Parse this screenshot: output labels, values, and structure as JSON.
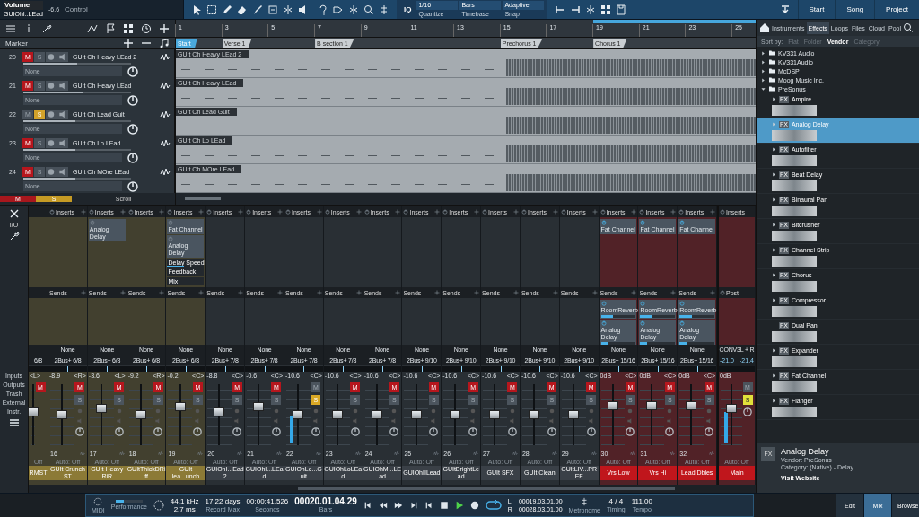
{
  "toolbar": {
    "control": {
      "param": "Volume",
      "channel": "GUIOhI..LEad",
      "value": "-6.6",
      "label": "Control"
    },
    "iq": "IQ",
    "quantize": {
      "value": "1/16",
      "label": "Quantize"
    },
    "timebase": {
      "value": "Bars",
      "label": "Timebase"
    },
    "snap": {
      "value": "Adaptive",
      "label": "Snap"
    },
    "pages": [
      {
        "label": "Start"
      },
      {
        "label": "Song"
      },
      {
        "label": "Project"
      }
    ]
  },
  "ruler": {
    "bars": [
      "1",
      "3",
      "5",
      "7",
      "9",
      "11",
      "13",
      "15",
      "17",
      "19",
      "21",
      "23",
      "25"
    ]
  },
  "markers": {
    "title": "Marker",
    "items": [
      {
        "name": "Start"
      },
      {
        "name": "Verse 1"
      },
      {
        "name": "B section 1"
      },
      {
        "name": "Prechorus 1"
      },
      {
        "name": "Chorus 1"
      }
    ]
  },
  "tracks": [
    {
      "number": "20",
      "name": "GUIt Ch Heavy LEad 2",
      "mute": true,
      "solo": false,
      "mute_label": "M",
      "solo_label": "S",
      "input": "None",
      "level": 0.5,
      "clip_name": "GUIt Ch Heavy LEad 2"
    },
    {
      "number": "21",
      "name": "GUIt Ch Heavy LEad",
      "mute": true,
      "solo": false,
      "mute_label": "M",
      "solo_label": "S",
      "input": "None",
      "level": 0.55,
      "clip_name": "GUIt Ch Heavy LEad"
    },
    {
      "number": "22",
      "name": "GUIt Ch Lead Guit",
      "mute": false,
      "solo": true,
      "mute_label": "M",
      "solo_label": "S",
      "input": "None",
      "level": 0.48,
      "clip_name": "GUIt Ch Lead Guit"
    },
    {
      "number": "23",
      "name": "GUIt Ch Lo LEad",
      "mute": true,
      "solo": false,
      "mute_label": "M",
      "solo_label": "S",
      "input": "None",
      "level": 0.48,
      "clip_name": "GUIt Ch Lo LEad"
    },
    {
      "number": "24",
      "name": "GUIt Ch MOre LEad",
      "mute": true,
      "solo": false,
      "mute_label": "M",
      "solo_label": "S",
      "input": "None",
      "level": 0.48,
      "clip_name": "GUIt Ch MOre LEad"
    }
  ],
  "arrange_footer": {
    "mute": "M",
    "solo": "S",
    "mode": "Scroll"
  },
  "mixer": {
    "panel": {
      "io": "I/O",
      "items": [
        "Inputs",
        "Outputs",
        "Trash",
        "External",
        "Instr."
      ]
    },
    "channels": [
      {
        "kind": "partial",
        "label": "RMST",
        "color": "#8c7a36",
        "routing": "6/8",
        "pan": "<L>",
        "mute": true,
        "mute_label": "M",
        "automation": "Off",
        "level": 0.55
      },
      {
        "kind": "strip",
        "number": "16",
        "label": "GUIt Crunch ST",
        "color": "#8c7a36",
        "inserts_label": "Inserts",
        "sends_label": "Sends",
        "input": "None",
        "routing": "2Bus+ 6/8",
        "volume": "-8.9",
        "pan": "<R>",
        "mute": true,
        "solo": false,
        "mute_label": "M",
        "solo_label": "S",
        "level": 0.5,
        "automation": "Auto: Off"
      },
      {
        "kind": "strip",
        "number": "17",
        "label": "GUIt Heavy RiR",
        "color": "#8c7a36",
        "inserts_label": "Inserts",
        "inserts": [
          {
            "name": "Analog Delay",
            "on": false
          }
        ],
        "sends_label": "Sends",
        "input": "None",
        "routing": "2Bus+ 6/8",
        "volume": "-3.6",
        "pan": "<L>",
        "mute": true,
        "solo": false,
        "mute_label": "M",
        "solo_label": "S",
        "level": 0.62,
        "automation": "Auto: Off"
      },
      {
        "kind": "strip",
        "number": "18",
        "label": "GUItThickDRiff",
        "color": "#8c7a36",
        "inserts_label": "Inserts",
        "sends_label": "Sends",
        "input": "None",
        "routing": "2Bus+ 6/8",
        "volume": "-9.2",
        "pan": "<R>",
        "mute": true,
        "solo": false,
        "mute_label": "M",
        "solo_label": "S",
        "level": 0.5,
        "automation": "Auto: Off"
      },
      {
        "kind": "strip",
        "number": "19",
        "label": "GUIt lea...unch",
        "color": "#8c7a36",
        "inserts_label": "Inserts",
        "inserts": [
          {
            "name": "Fat Channel",
            "on": false
          },
          {
            "name": "Analog Delay",
            "on": false,
            "params": [
              {
                "name": "Delay Speed",
                "level": 0.45
              },
              {
                "name": "Feedback",
                "level": 0.12
              },
              {
                "name": "Mix",
                "level": 0.1
              }
            ]
          }
        ],
        "sends_label": "Sends",
        "input": "None",
        "routing": "2Bus+ 6/8",
        "volume": "-0.2",
        "pan": "<C>",
        "mute": true,
        "solo": false,
        "mute_label": "M",
        "solo_label": "S",
        "level": 0.65,
        "automation": "Auto: Off"
      },
      {
        "kind": "strip",
        "number": "20",
        "label": "GUIOhI...Ead2",
        "color": "#3a4047",
        "inserts_label": "Inserts",
        "sends_label": "Sends",
        "input": "None",
        "routing": "2Bus+ 7/8",
        "volume": "-8.8",
        "pan": "<C>",
        "mute": true,
        "solo": false,
        "mute_label": "M",
        "solo_label": "S",
        "level": 0.55,
        "automation": "Auto: Off"
      },
      {
        "kind": "strip",
        "number": "21",
        "label": "GUIOhI...LEad",
        "color": "#3a4047",
        "inserts_label": "Inserts",
        "sends_label": "Sends",
        "input": "None",
        "routing": "2Bus+ 7/8",
        "volume": "-0.6",
        "pan": "<C>",
        "mute": true,
        "solo": false,
        "mute_label": "M",
        "solo_label": "S",
        "level": 0.65,
        "automation": "Auto: Off"
      },
      {
        "kind": "strip",
        "number": "22",
        "label": "GUIOhLe...Guit",
        "color": "#3a4047",
        "inserts_label": "Inserts",
        "sends_label": "Sends",
        "input": "None",
        "routing": "2Bus+ 7/8",
        "volume": "-10.6",
        "pan": "<C>",
        "mute": false,
        "solo": true,
        "mute_label": "M",
        "solo_label": "S",
        "level": 0.5,
        "meter": {
          "level": 0.45
        },
        "automation": "Auto: Off"
      },
      {
        "kind": "strip",
        "number": "23",
        "label": "GUIOhLoLEad",
        "color": "#3a4047",
        "inserts_label": "Inserts",
        "sends_label": "Sends",
        "input": "None",
        "routing": "2Bus+ 7/8",
        "volume": "-10.6",
        "pan": "<C>",
        "mute": true,
        "solo": false,
        "mute_label": "M",
        "solo_label": "S",
        "level": 0.5,
        "automation": "Auto: Off"
      },
      {
        "kind": "strip",
        "number": "24",
        "label": "GUIOhM...LEad",
        "color": "#3a4047",
        "inserts_label": "Inserts",
        "sends_label": "Sends",
        "input": "None",
        "routing": "2Bus+ 7/8",
        "volume": "-10.6",
        "pan": "<C>",
        "mute": true,
        "solo": false,
        "mute_label": "M",
        "solo_label": "S",
        "level": 0.5,
        "automation": "Auto: Off"
      },
      {
        "kind": "strip",
        "number": "25",
        "label": "GUIOhIILead",
        "color": "#3a4047",
        "inserts_label": "Inserts",
        "sends_label": "Sends",
        "input": "None",
        "routing": "2Bus+ 9/10",
        "volume": "-10.6",
        "pan": "<C>",
        "mute": true,
        "solo": false,
        "mute_label": "M",
        "solo_label": "S",
        "level": 0.5,
        "automation": "Auto: Off"
      },
      {
        "kind": "strip",
        "number": "26",
        "label": "GUItBrightLead",
        "color": "#3a4047",
        "inserts_label": "Inserts",
        "sends_label": "Sends",
        "input": "None",
        "routing": "2Bus+ 9/10",
        "volume": "-10.6",
        "pan": "<C>",
        "mute": true,
        "solo": false,
        "mute_label": "M",
        "solo_label": "S",
        "level": 0.5,
        "automation": "Auto: Off"
      },
      {
        "kind": "strip",
        "number": "27",
        "label": "GUIt SFX",
        "color": "#3a4047",
        "inserts_label": "Inserts",
        "sends_label": "Sends",
        "input": "None",
        "routing": "2Bus+ 9/10",
        "volume": "-10.6",
        "pan": "<C>",
        "mute": true,
        "solo": false,
        "mute_label": "M",
        "solo_label": "S",
        "level": 0.5,
        "automation": "Auto: Off"
      },
      {
        "kind": "strip",
        "number": "28",
        "label": "GUIt Clean",
        "color": "#3a4047",
        "inserts_label": "Inserts",
        "sends_label": "Sends",
        "input": "None",
        "routing": "2Bus+ 9/10",
        "volume": "-10.6",
        "pan": "<C>",
        "mute": true,
        "solo": false,
        "mute_label": "M",
        "solo_label": "S",
        "level": 0.5,
        "automation": "Auto: Off"
      },
      {
        "kind": "strip",
        "number": "29",
        "label": "GUItLIV...PREF",
        "color": "#3a4047",
        "inserts_label": "Inserts",
        "sends_label": "Sends",
        "input": "None",
        "routing": "2Bus+ 9/10",
        "volume": "-10.6",
        "pan": "<C>",
        "mute": true,
        "solo": false,
        "mute_label": "M",
        "solo_label": "S",
        "level": 0.5,
        "automation": "Auto: Off"
      },
      {
        "kind": "strip",
        "number": "30",
        "label": "Vrs Low",
        "color": "#c0161c",
        "inserts_label": "Inserts",
        "inserts": [
          {
            "name": "Fat Channel",
            "on": true
          }
        ],
        "sends_label": "Sends",
        "sends": [
          {
            "name": "RoomReverb",
            "level": 0.35
          },
          {
            "name": "Analog Delay",
            "level": 0.2
          }
        ],
        "input": "None",
        "routing": "2Bus+ 15/16",
        "volume": "0dB",
        "pan": "<C>",
        "mute": true,
        "solo": false,
        "mute_label": "M",
        "solo_label": "S",
        "level": 0.68,
        "automation": "Auto: Off"
      },
      {
        "kind": "strip",
        "number": "31",
        "label": "Vrs Hi",
        "color": "#c0161c",
        "inserts_label": "Inserts",
        "inserts": [
          {
            "name": "Fat Channel",
            "on": true
          }
        ],
        "sends_label": "Sends",
        "sends": [
          {
            "name": "RoomReverb",
            "level": 0.35
          },
          {
            "name": "Analog Delay",
            "level": 0.2
          }
        ],
        "input": "None",
        "routing": "2Bus+ 15/16",
        "volume": "0dB",
        "pan": "<C>",
        "mute": true,
        "solo": false,
        "mute_label": "M",
        "solo_label": "S",
        "level": 0.68,
        "automation": "Auto: Off"
      },
      {
        "kind": "strip",
        "number": "32",
        "label": "Lead Dbles",
        "color": "#c0161c",
        "inserts_label": "Inserts",
        "inserts": [
          {
            "name": "Fat Channel",
            "on": true
          }
        ],
        "sends_label": "Sends",
        "sends": [
          {
            "name": "RoomReverb",
            "level": 0.35
          },
          {
            "name": "Analog Delay",
            "level": 0.2
          }
        ],
        "input": "None",
        "routing": "2Bus+ 15/16",
        "volume": "0dB",
        "pan": "<C>",
        "mute": true,
        "solo": false,
        "mute_label": "M",
        "solo_label": "S",
        "level": 0.68,
        "automation": "Auto: Off"
      }
    ],
    "main": {
      "label": "Main",
      "color": "#c0161c",
      "inserts_label": "Inserts",
      "post_label": "Post",
      "output": "CONV3L + R",
      "peak_l": "-21.0",
      "peak_r": "-21.4",
      "volume": "0dB",
      "mute": false,
      "solo": true,
      "mute_label": "M",
      "solo_label": "S",
      "level": 0.62,
      "meter": {
        "level": 0.5
      },
      "automation": "Auto: Off"
    }
  },
  "browser": {
    "tabs": [
      {
        "label": "Instruments",
        "selected": false
      },
      {
        "label": "Effects",
        "selected": true
      },
      {
        "label": "Loops",
        "selected": false
      },
      {
        "label": "Files",
        "selected": false
      },
      {
        "label": "Cloud",
        "selected": false
      },
      {
        "label": "Pool",
        "selected": false
      }
    ],
    "sort": {
      "label": "Sort by:",
      "options": [
        {
          "label": "Flat",
          "selected": false
        },
        {
          "label": "Folder",
          "selected": false
        },
        {
          "label": "Vendor",
          "selected": true
        },
        {
          "label": "Category",
          "selected": false
        }
      ]
    },
    "vendors": [
      {
        "name": "KV331 Audio",
        "expanded": false
      },
      {
        "name": "KV331Audio",
        "expanded": false
      },
      {
        "name": "McDSP",
        "expanded": false
      },
      {
        "name": "Moog Music Inc.",
        "expanded": false
      },
      {
        "name": "PreSonus",
        "expanded": true,
        "children": [
          {
            "name": "Ampire",
            "badge": "FX",
            "selected": false,
            "expandable": true
          },
          {
            "name": "Analog Delay",
            "badge": "FX",
            "selected": true,
            "expandable": true
          },
          {
            "name": "Autofilter",
            "badge": "FX",
            "selected": false,
            "expandable": true
          },
          {
            "name": "Beat Delay",
            "badge": "FX",
            "selected": false,
            "expandable": true
          },
          {
            "name": "Binaural Pan",
            "badge": "FX",
            "selected": false,
            "expandable": true
          },
          {
            "name": "Bitcrusher",
            "badge": "FX",
            "selected": false,
            "expandable": true
          },
          {
            "name": "Channel Strip",
            "badge": "FX",
            "selected": false,
            "expandable": true
          },
          {
            "name": "Chorus",
            "badge": "FX",
            "selected": false,
            "expandable": true
          },
          {
            "name": "Compressor",
            "badge": "FX",
            "selected": false,
            "expandable": true
          },
          {
            "name": "Dual Pan",
            "badge": "FX",
            "selected": false,
            "expandable": false
          },
          {
            "name": "Expander",
            "badge": "FX",
            "selected": false,
            "expandable": true
          },
          {
            "name": "Fat Channel",
            "badge": "FX",
            "selected": false,
            "expandable": true
          },
          {
            "name": "Flanger",
            "badge": "FX",
            "selected": false,
            "expandable": true
          }
        ]
      }
    ],
    "info": {
      "badge": "FX",
      "name": "Analog Delay",
      "vendor_label": "Vendor:",
      "vendor": "PreSonus",
      "category_label": "Category:",
      "category": "(Native) - Delay",
      "link": "Visit Website"
    }
  },
  "transport": {
    "midi": "MIDI",
    "performance": {
      "label": "Performance",
      "level": 0.3
    },
    "sample_rate": "44.1 kHz",
    "latency": "2.7 ms",
    "record_time": "17:22 days",
    "record_label": "Record Max",
    "seconds": "00:00:41.526",
    "seconds_label": "Seconds",
    "bars": "00020.01.04.29",
    "bars_label": "Bars",
    "loop_on": true,
    "l_label": "L",
    "l": "00019.03.01.00",
    "r_label": "R",
    "r": "00028.03.01.00",
    "metronome": "Metronome",
    "timing": "4 / 4",
    "timing_label": "Timing",
    "tempo": "111.00",
    "tempo_label": "Tempo"
  },
  "views": [
    {
      "label": "Edit",
      "selected": false
    },
    {
      "label": "Mix",
      "selected": true
    },
    {
      "label": "Browse",
      "selected": false
    }
  ]
}
